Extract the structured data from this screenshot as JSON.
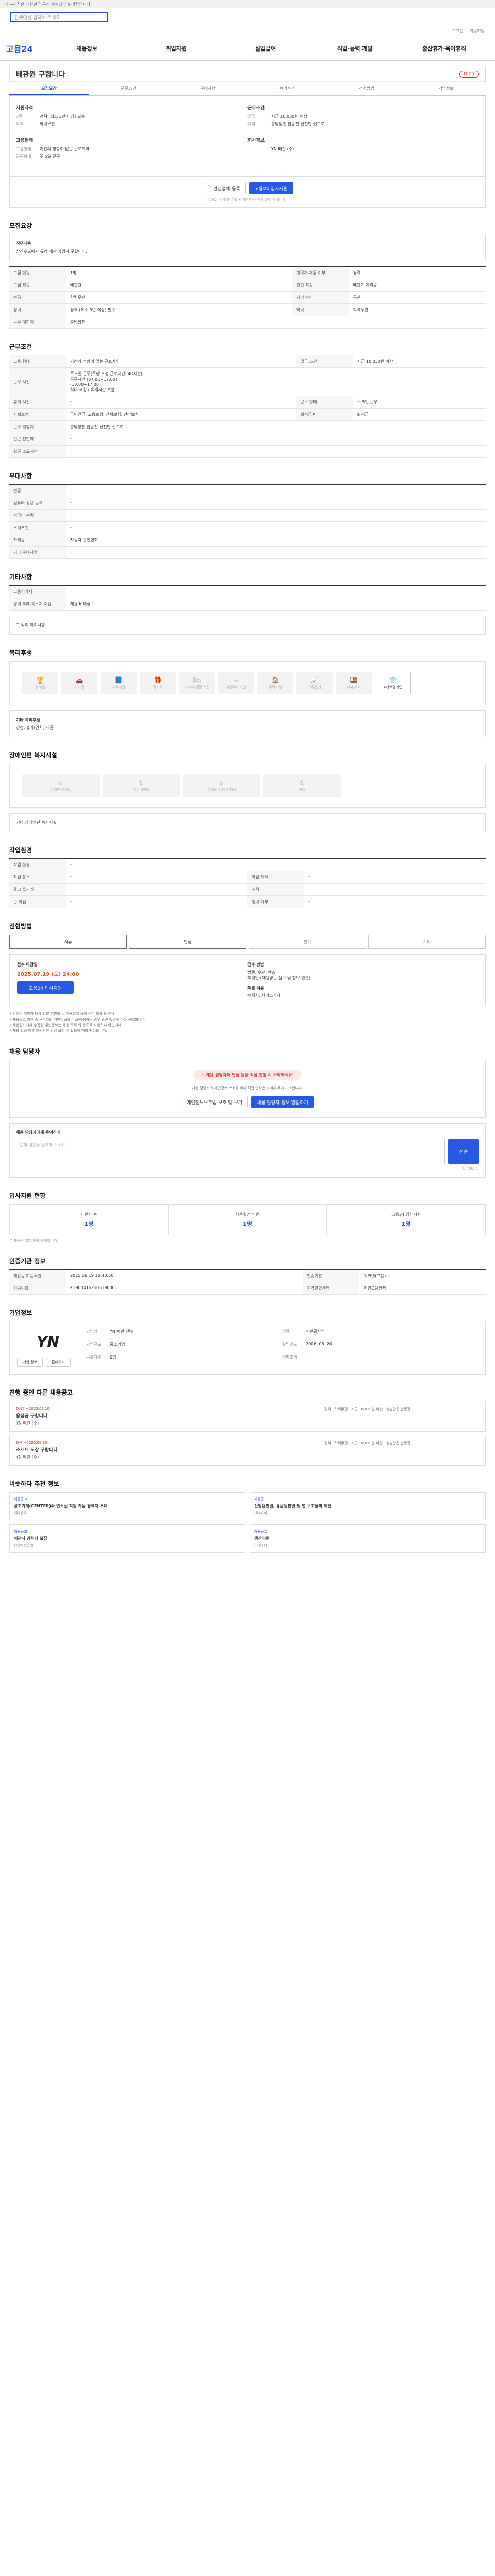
{
  "topbar": {
    "notice": "이 누리집은 대한민국 공식 전자정부 누리집입니다."
  },
  "search": {
    "placeholder": "검색어를 입력해 주세요."
  },
  "util": [
    "로그인",
    "회원가입"
  ],
  "gnb": {
    "logo": "고용24",
    "items": [
      "채용정보",
      "취업지원",
      "실업급여",
      "직업·능력 개발",
      "출산휴가·육아휴직"
    ]
  },
  "job": {
    "title": "배관원 구합니다",
    "badge": "D-27",
    "tabs": [
      "모집요강",
      "근무조건",
      "우대사항",
      "복리후생",
      "전형방법",
      "기업정보"
    ],
    "summary": {
      "recruit": {
        "head": "지원자격",
        "rows": [
          [
            "경력",
            "경력 (최소 3년 이상) 필수"
          ],
          [
            "학력",
            "학력무관"
          ]
        ]
      },
      "work": {
        "head": "근무조건",
        "rows": [
          [
            "임금",
            "시급 10,030원 이상"
          ],
          [
            "지역",
            "충남당진 합동전 신천면 신도로"
          ]
        ]
      },
      "type": {
        "head": "고용형태",
        "rows": [
          [
            "고용형태",
            "기간의 정함이 없는 근로계약"
          ],
          [
            "근무형태",
            "주 5일 근무"
          ]
        ]
      },
      "company": {
        "head": "회사정보",
        "rows": [
          [
            "",
            "YN 배관 (주)"
          ]
        ]
      }
    },
    "actions": {
      "save": "관심업체 등록",
      "apply": "고용24 입사지원",
      "note": "고용24 입사지원 완료 시 지원자 이력서를 열람 가능합니다."
    }
  },
  "sections": {
    "recruit": "모집요강",
    "condition": "근무조건",
    "pref": "우대사항",
    "etc": "기타사항",
    "welfare": "복리후생",
    "disabled": "장애인편 복지시설",
    "env": "작업환경",
    "method": "전형방법",
    "contact": "채용 담당자",
    "stats": "입사지원 현황",
    "info": "인증기관 정보",
    "corp": "기업정보",
    "others": "진행 중인 다른 채용공고",
    "recs": "비슷하다 추천 정보"
  },
  "recruit_box": {
    "label": "직무내용",
    "text": "상하수도배관 유경 배관 가업하 구합니다."
  },
  "recruit_table": [
    [
      "모집 인원",
      "1명",
      "경력자 채용 여부",
      "경력"
    ],
    [
      "모집 직종",
      "배관원",
      "관련 직종",
      "배관기 자격증"
    ],
    [
      "전공",
      "학력무관",
      "자격 면허",
      "무관"
    ],
    [
      "경력",
      "경력 (최소 3년 이상) 필수",
      "학력",
      "학력무관"
    ],
    [
      "근무 예정지",
      "충남당진",
      "",
      ""
    ]
  ],
  "condition_table": [
    [
      "고용 형태",
      "기간의 정함이 없는 근로계약",
      "임금 조건",
      "시급 10,030원 이상"
    ],
    [
      "근무 시간",
      "주 5일 근무(주당 소정 근로시간: 40시간)\n근무시간 (07:00~17:00)\n(13:00~17:00)\n식대 포함 / 휴게시간 포함",
      "",
      ""
    ],
    [
      "휴게 시간",
      "-",
      "근무 형태",
      "주 5일 근무"
    ],
    [
      "사회보험",
      "국민연금, 고용보험, 산재보험, 건강보험",
      "퇴직급여",
      "퇴직금"
    ],
    [
      "근무 예정지",
      "충남당진 합동전 신천면 신도로",
      "",
      ""
    ],
    [
      "인근 전철역",
      "-",
      "",
      ""
    ],
    [
      "최근 소요시간",
      "-",
      "",
      ""
    ]
  ],
  "pref_table": [
    [
      "전공",
      "-"
    ],
    [
      "컴퓨터 활용 능력",
      "-"
    ],
    [
      "외국어 능력",
      "-"
    ],
    [
      "우대조건",
      "-"
    ],
    [
      "자격증",
      "자동차 운전면허"
    ],
    [
      "기타 우대사항",
      "-"
    ]
  ],
  "etc_table": [
    [
      "고용허가제",
      "-"
    ],
    [
      "병역 특례 복무처 채용",
      "채용 비대상"
    ]
  ],
  "etc_note": "그 밖의 특이사항",
  "welfare_items": [
    {
      "icon": "trophy-icon",
      "label": "상여금",
      "on": false
    },
    {
      "icon": "car-icon",
      "label": "자가용",
      "on": false
    },
    {
      "icon": "book-icon",
      "label": "교육지원",
      "on": false
    },
    {
      "icon": "gift-icon",
      "label": "경조사",
      "on": false
    },
    {
      "icon": "bed-icon",
      "label": "기숙사/생활·보건",
      "on": false
    },
    {
      "icon": "coffee-icon",
      "label": "차량유지지원",
      "on": false
    },
    {
      "icon": "house-icon",
      "label": "주택지원",
      "on": false
    },
    {
      "icon": "chart-icon",
      "label": "스톡옵션",
      "on": false
    },
    {
      "icon": "meal-icon",
      "label": "식사/다과",
      "on": false
    },
    {
      "icon": "shirt-icon",
      "label": "4대보험가입",
      "on": true
    }
  ],
  "welfare_note": "기타 복리후생",
  "welfare_note2": "건강, 휴가(연차) 제공",
  "disabled_items": [
    "장애인 화장실",
    "엘리베이터",
    "장애인 전용 주차장",
    "기타"
  ],
  "disabled_note": "기타 장애인편 복지시설",
  "env_table": [
    [
      "작업 환경",
      "-",
      "",
      ""
    ],
    [
      "작업 장소",
      "-",
      "작업 자세",
      "-"
    ],
    [
      "들고 옮기기",
      "-",
      "시력",
      "-"
    ],
    [
      "손 작업",
      "-",
      "청력 여부",
      "-"
    ]
  ],
  "method": {
    "items": [
      "서류",
      "면접",
      "필기",
      "기타"
    ],
    "on": [
      true,
      true,
      false,
      false
    ]
  },
  "apply": {
    "period_h": "접수 마감일",
    "period": "2025.07.19 (토) 24:00",
    "apply_btn": "고용24 입사지원",
    "method_h": "접수 방법",
    "methods": "방문, 우편, 팩스\n이메일 (채용방문 접수 및 정보 연결)",
    "required_h": "제출 서류",
    "required": "이력서, 자기소개서",
    "bullets": [
      "장애인 지원자 대상 선발 위원회 및 채용절차 등에 관한 법률 등 안내",
      "채용공고 기간 중 구직자의 개인정보를 수집·이용하는 경우 관련 법령에 따라 관리합니다.",
      "채용절차에서 수집한 개인정보는 채용 목적 외 용도로 사용하지 않습니다.",
      "채용 확정 이후 지원서류 반환 요청 시 법률에 따라 처리합니다."
    ]
  },
  "contact": {
    "alert": "채용 담당자와 면접 등을 직접 진행 시 주의하세요!",
    "desc": "채용 담당자의 개인정보 보호를 위해 직접 연락은 자제해 주시기 바랍니다.",
    "btn1": "개인정보보호법 보호 및 보기",
    "btn2": "채용 담당자 정보 열람하기"
  },
  "inquiry": {
    "label": "채용 담당자에게 문의하기",
    "placeholder": "문의 내용을 입력해 주세요.",
    "submit": "전송",
    "count": "0 / 500자"
  },
  "stats": [
    {
      "label": "지원자 수",
      "value": "1명"
    },
    {
      "label": "채용결정 인원",
      "value": "1명"
    },
    {
      "label": "고용24 입사지원",
      "value": "1명"
    }
  ],
  "stats_note": "본 채용은 업체 현황 통계입니다.",
  "info_table": [
    [
      "채용공고 등록일",
      "2025.06.19 11:48:50",
      "인증기관",
      "워크넷(고용)"
    ],
    [
      "인증번호",
      "K190041625061900001",
      "지역관할센터",
      "천안고용센터"
    ]
  ],
  "corp": {
    "logo": "YN",
    "rows": [
      [
        "기업명",
        "YN 배관 (주)"
      ],
      [
        "업종",
        "배관공사업"
      ],
      [
        "기업규모",
        "중소기업"
      ],
      [
        "설립년도",
        "2006. 06. 20."
      ],
      [
        "근로자수",
        "6명"
      ],
      [
        "연매출액",
        "-"
      ]
    ],
    "btns": [
      "기업 정보",
      "홈페이지"
    ]
  },
  "others": [
    {
      "dday": "D-17",
      "date": "~2025.07.10",
      "title": "용접공 구합니다",
      "company": "YN 배관 (주)",
      "meta": "경력 · 학력무관 · 시급 10,030원 이상 · 충남당진 합동전"
    },
    {
      "dday": "D-7",
      "date": "~2025.06.30",
      "title": "소프트 도장 구합니다",
      "company": "YN 배관 (주)",
      "meta": "경력 · 학력무관 · 시급 10,030원 이상 · 충남당진 합동전"
    }
  ],
  "recs": [
    {
      "tag": "채용공고",
      "title": "공조기계(CENTER)와 연소실 직원 가능 경력자 우대",
      "company": "(주)동우"
    },
    {
      "tag": "채용공고",
      "title": "산업용판넬, 유공원판넬 및 열 구조물의 제관",
      "company": "(주)세이"
    },
    {
      "tag": "채용공고",
      "title": "배관사 경력자 모집",
      "company": "(주)한성산업"
    },
    {
      "tag": "채용공고",
      "title": "생산직원",
      "company": "(주)나나"
    }
  ],
  "colors": {
    "accent": "#2659e6",
    "danger": "#e2531f"
  }
}
